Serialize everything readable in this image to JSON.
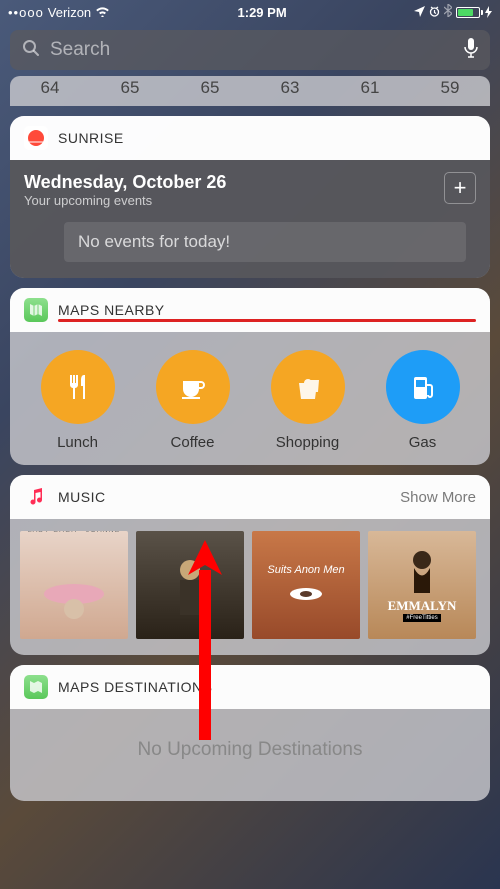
{
  "status": {
    "signal": "••ooo",
    "carrier": "Verizon",
    "time": "1:29 PM"
  },
  "search": {
    "placeholder": "Search"
  },
  "peek_values": [
    "64",
    "65",
    "65",
    "63",
    "61",
    "59"
  ],
  "sunrise": {
    "title": "SUNRISE",
    "date": "Wednesday, October 26",
    "subtitle": "Your upcoming events",
    "empty": "No events for today!"
  },
  "maps_nearby": {
    "title": "MAPS NEARBY",
    "items": [
      {
        "label": "Lunch",
        "color": "#f5a623",
        "icon": "lunch"
      },
      {
        "label": "Coffee",
        "color": "#f5a623",
        "icon": "coffee"
      },
      {
        "label": "Shopping",
        "color": "#f5a623",
        "icon": "shopping"
      },
      {
        "label": "Gas",
        "color": "#1e9df7",
        "icon": "gas"
      }
    ]
  },
  "music": {
    "title": "MUSIC",
    "show_more": "Show More",
    "albums": [
      {
        "label": "LADY GAGA · JOANNE",
        "bg": "#d9b8a8"
      },
      {
        "label": "",
        "bg": "#4a4238"
      },
      {
        "label": "Suits Anon Men",
        "bg": "#a85a3a"
      },
      {
        "label": "EMMALYN",
        "bg": "#c89a7a"
      }
    ]
  },
  "maps_dest": {
    "title": "MAPS DESTINATIONS",
    "empty": "No Upcoming Destinations"
  }
}
